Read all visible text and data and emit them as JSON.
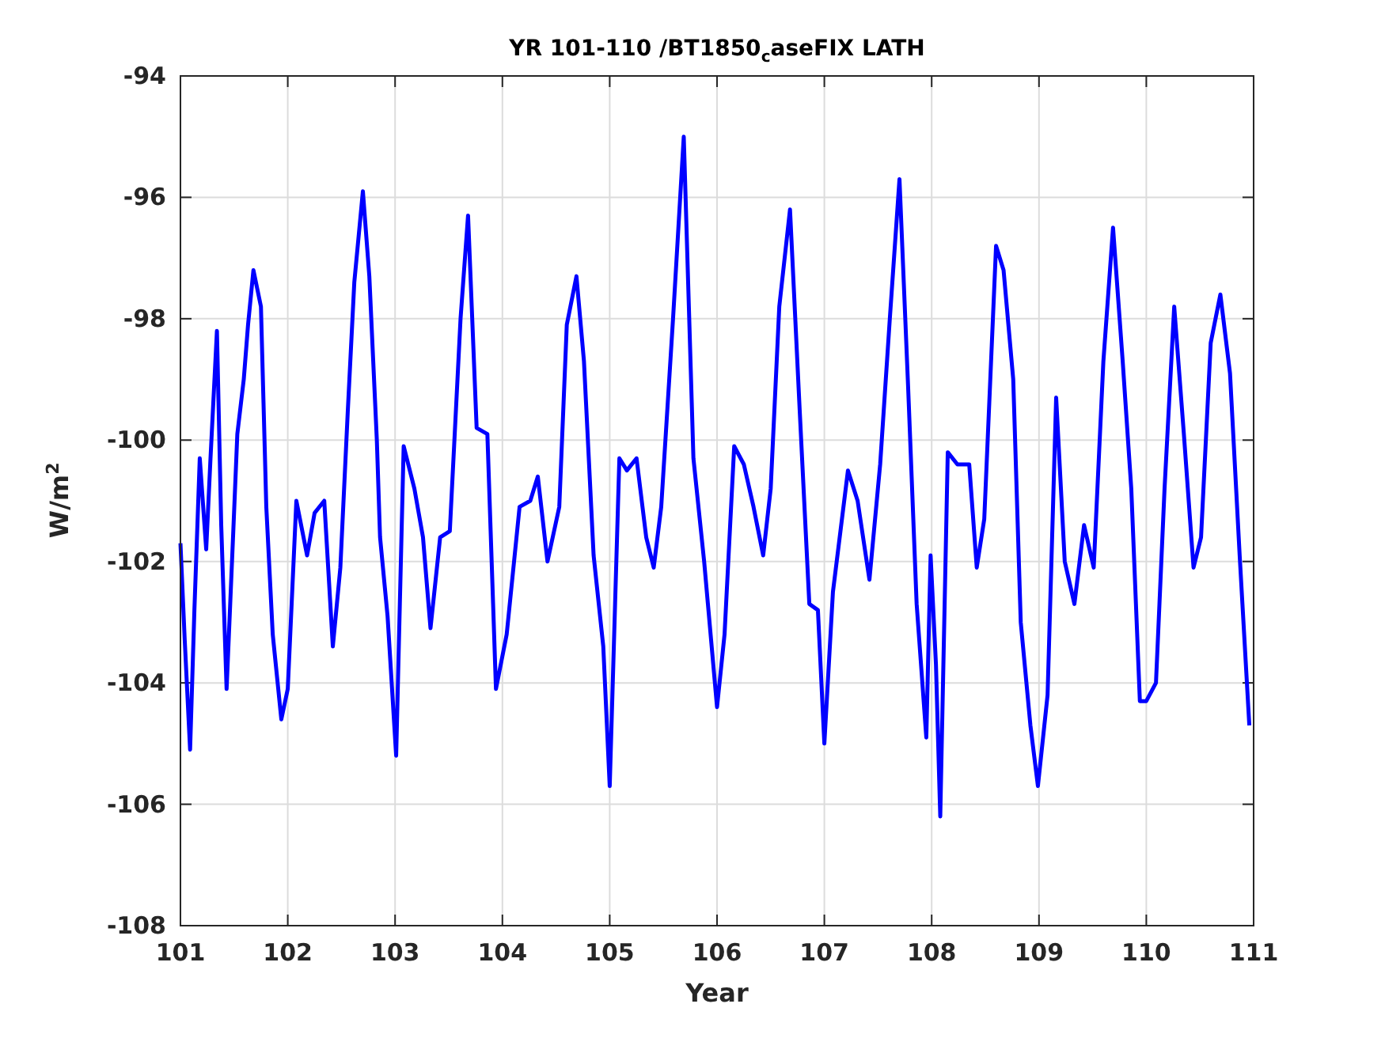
{
  "figure": {
    "title": "YR 101-110 /BT1850$_{c}$aseFIX LATH",
    "chart_data": {
      "type": "line",
      "xlabel": "Year",
      "ylabel": "W/m$^{2}$",
      "xlim": [
        101,
        111
      ],
      "ylim": [
        -108,
        -94
      ],
      "xticks": [
        101,
        102,
        103,
        104,
        105,
        106,
        107,
        108,
        109,
        110,
        111
      ],
      "yticks": [
        -108,
        -106,
        -104,
        -102,
        -100,
        -98,
        -96,
        -94
      ],
      "x": [
        101.0,
        101.04,
        101.09,
        101.13,
        101.18,
        101.24,
        101.28,
        101.34,
        101.38,
        101.43,
        101.49,
        101.53,
        101.59,
        101.63,
        101.68,
        101.75,
        101.8,
        101.86,
        101.94,
        102.0,
        102.08,
        102.18,
        102.25,
        102.34,
        102.42,
        102.49,
        102.56,
        102.62,
        102.7,
        102.76,
        102.83,
        102.86,
        102.93,
        103.01,
        103.08,
        103.18,
        103.26,
        103.33,
        103.42,
        103.51,
        103.61,
        103.68,
        103.76,
        103.86,
        103.94,
        104.04,
        104.16,
        104.26,
        104.33,
        104.42,
        104.53,
        104.6,
        104.69,
        104.76,
        104.85,
        104.94,
        105.0,
        105.09,
        105.16,
        105.25,
        105.34,
        105.41,
        105.48,
        105.59,
        105.69,
        105.78,
        105.88,
        106.0,
        106.07,
        106.16,
        106.25,
        106.34,
        106.43,
        106.5,
        106.58,
        106.68,
        106.77,
        106.86,
        106.94,
        107.0,
        107.08,
        107.15,
        107.22,
        107.31,
        107.42,
        107.52,
        107.61,
        107.7,
        107.78,
        107.86,
        107.95,
        107.99,
        108.04,
        108.08,
        108.15,
        108.24,
        108.35,
        108.42,
        108.49,
        108.6,
        108.67,
        108.76,
        108.83,
        108.92,
        108.99,
        109.08,
        109.16,
        109.24,
        109.33,
        109.42,
        109.51,
        109.6,
        109.69,
        109.78,
        109.86,
        109.94,
        110.0,
        110.09,
        110.17,
        110.26,
        110.35,
        110.44,
        110.51,
        110.6,
        110.69,
        110.78,
        110.87,
        110.96
      ],
      "grid": true,
      "series": [
        {
          "color": "#0000ff",
          "values": [
            -101.7,
            -103.3,
            -105.1,
            -102.8,
            -100.3,
            -101.8,
            -100.3,
            -98.2,
            -101.4,
            -104.1,
            -101.6,
            -99.9,
            -99.0,
            -98.1,
            -97.2,
            -97.8,
            -101.1,
            -103.2,
            -104.6,
            -104.1,
            -101.0,
            -101.9,
            -101.2,
            -101.0,
            -103.4,
            -102.1,
            -99.5,
            -97.4,
            -95.9,
            -97.3,
            -100.0,
            -101.6,
            -102.9,
            -105.2,
            -100.1,
            -100.8,
            -101.6,
            -103.1,
            -101.6,
            -101.5,
            -98.0,
            -96.3,
            -99.8,
            -99.9,
            -104.1,
            -103.2,
            -101.1,
            -101.0,
            -100.6,
            -102.0,
            -101.1,
            -98.1,
            -97.3,
            -98.7,
            -101.9,
            -103.4,
            -105.7,
            -100.3,
            -100.5,
            -100.3,
            -101.6,
            -102.1,
            -101.1,
            -98.0,
            -95.0,
            -100.3,
            -102.0,
            -104.4,
            -103.2,
            -100.1,
            -100.4,
            -101.1,
            -101.9,
            -100.8,
            -97.8,
            -96.2,
            -99.5,
            -102.7,
            -102.8,
            -105.0,
            -102.5,
            -101.5,
            -100.5,
            -101.0,
            -102.3,
            -100.4,
            -98.0,
            -95.7,
            -99.1,
            -102.7,
            -104.9,
            -101.9,
            -103.7,
            -106.2,
            -100.2,
            -100.4,
            -100.4,
            -102.1,
            -101.3,
            -96.8,
            -97.2,
            -99.0,
            -103.0,
            -104.7,
            -105.7,
            -104.2,
            -99.3,
            -102.0,
            -102.7,
            -101.4,
            -102.1,
            -98.7,
            -96.5,
            -98.7,
            -100.8,
            -104.3,
            -104.3,
            -104.0,
            -100.8,
            -97.8,
            -99.9,
            -102.1,
            -101.6,
            -98.4,
            -97.6,
            -98.9,
            -101.9,
            -104.7
          ]
        }
      ]
    }
  }
}
